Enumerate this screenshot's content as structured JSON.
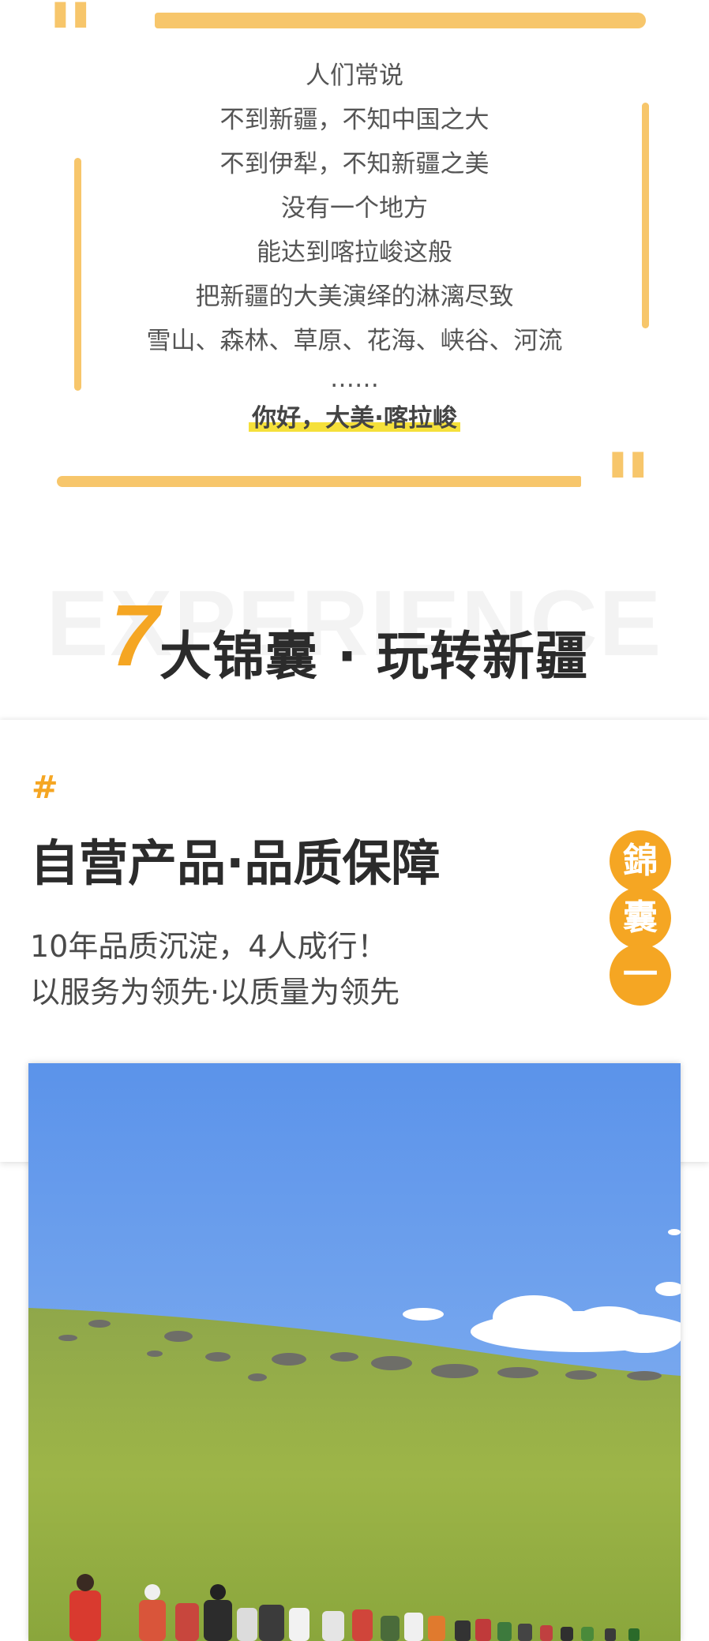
{
  "intro": {
    "lines": [
      "人们常说",
      "不到新疆，不知中国之大",
      "不到伊犁，不知新疆之美",
      "没有一个地方",
      "能达到喀拉峻这般",
      "把新疆的大美演绎的淋漓尽致",
      "雪山、森林、草原、花海、峡谷、河流",
      "……"
    ],
    "highlight": "你好，大美·喀拉峻"
  },
  "section": {
    "bg_word": "EXPERIENCE",
    "number": "7",
    "title": "大锦囊 · 玩转新疆"
  },
  "card": {
    "hash": "#",
    "title": "自营产品·品质保障",
    "desc_line1": "10年品质沉淀，4人成行！",
    "desc_line2": "以服务为领先·以质量为领先",
    "seal": [
      "錦",
      "囊",
      "一"
    ]
  },
  "colors": {
    "accent": "#F5A623",
    "brush": "#F7C66B",
    "highlight": "#F5E03A",
    "title": "#2b2b2b"
  },
  "photo": {
    "subject": "hikers-on-grassland"
  }
}
